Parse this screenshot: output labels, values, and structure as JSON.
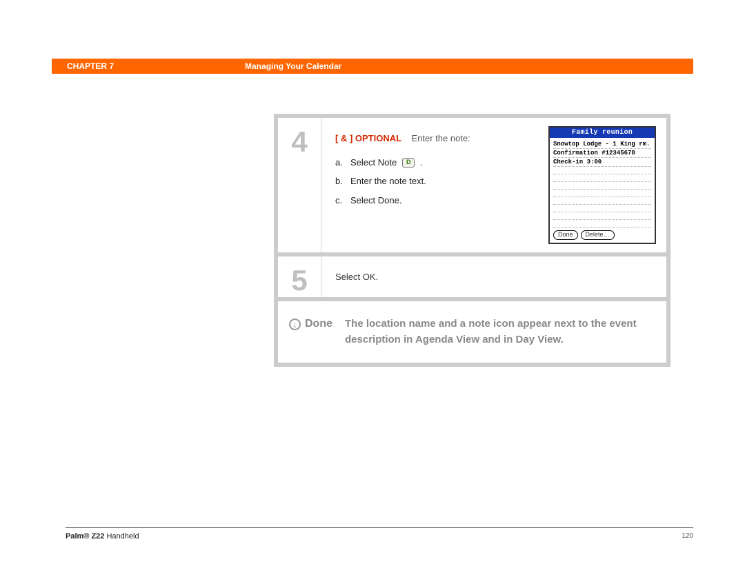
{
  "header": {
    "chapter_label": "CHAPTER 7",
    "chapter_title": "Managing Your Calendar"
  },
  "steps": {
    "step4": {
      "number": "4",
      "optional_prefix": "[ & ]  OPTIONAL",
      "optional_trail": "Enter the note:",
      "sub_a_letter": "a.",
      "sub_a_text": "Select Note",
      "sub_b_letter": "b.",
      "sub_b_text": "Enter the note text.",
      "sub_c_letter": "c.",
      "sub_c_text": "Select Done.",
      "note_icon_glyph": "D"
    },
    "step5": {
      "number": "5",
      "text": "Select OK."
    }
  },
  "palm": {
    "title": "Family reunion",
    "line1": "Snowtop Lodge - 1 King rm.",
    "line2": "Confirmation #12345678",
    "line3": "Check-in 3:00",
    "btn_done": "Done",
    "btn_delete": "Delete…"
  },
  "done": {
    "label": "Done",
    "text": "The location name and a note icon appear next to the event description in Agenda View and in Day View."
  },
  "footer": {
    "product_bold": "Palm® Z22",
    "product_rest": " Handheld",
    "page": "120"
  }
}
